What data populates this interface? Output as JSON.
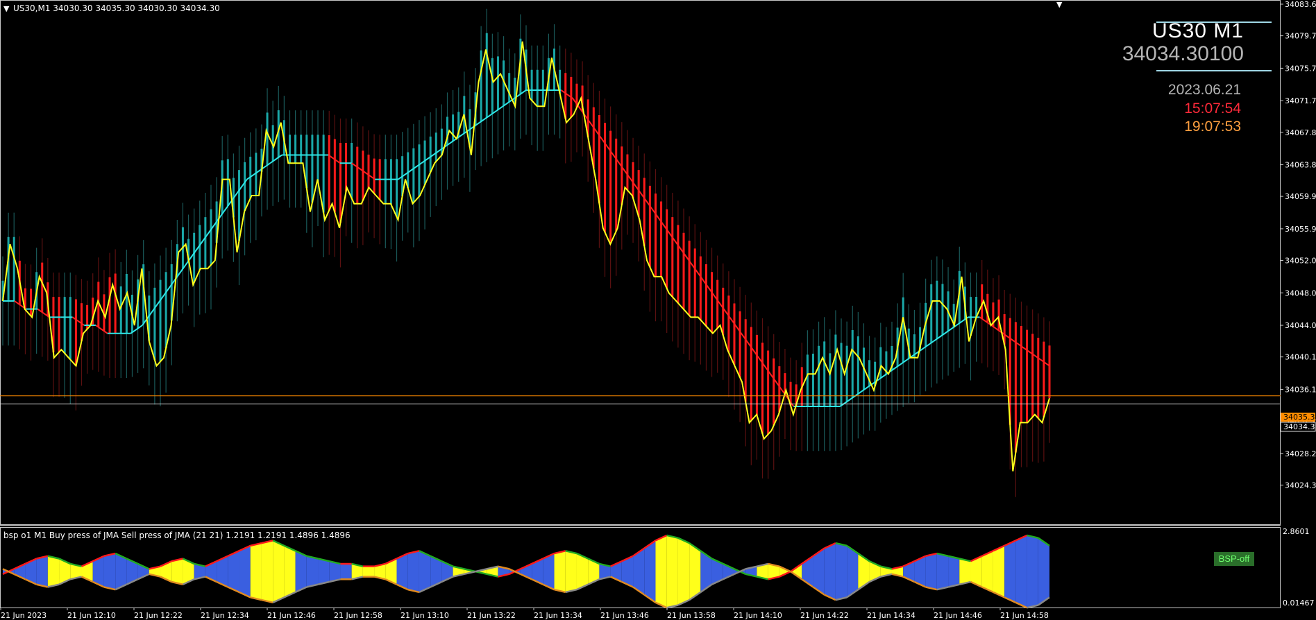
{
  "header": {
    "title": "US30,M1  34030.30 34035.30 34030.30 34034.30"
  },
  "info_panel": {
    "symbol": "US30  M1",
    "bid": "34034.30100",
    "date": "2023.06.21",
    "server_time": "15:07:54",
    "local_time": "19:07:53"
  },
  "sub_window": {
    "title": "bsp o1 M1 Buy press of JMA Sell press of JMA (21 21) 1.2191 1.2191 1.4896 1.4896",
    "y_max_label": "2.8601",
    "y_min_label": "0.01467",
    "button_label": "BSP-off"
  },
  "colors": {
    "bull_histogram": "#1aa8a8",
    "bear_histogram": "#ff1a1a",
    "price_line": "#ffff1a",
    "ma_up": "#2ee6e6",
    "ma_down": "#ff2020",
    "ask_line": "#ff8c00",
    "bid_line": "#e0e0e0",
    "osc_blue": "#3a5fe0",
    "osc_yellow": "#ffff1a",
    "osc_green": "#22aa22",
    "osc_red": "#ff1a1a"
  },
  "chart_data": [
    {
      "type": "line",
      "panel": "main",
      "ylim": [
        34021,
        34083.6
      ],
      "y_ticks": [
        "34083.6",
        "34079.7",
        "34075.7",
        "34071.7",
        "34067.8",
        "34063.8",
        "34059.9",
        "34055.9",
        "34052.0",
        "34048.0",
        "34044.0",
        "34040.1",
        "34036.1",
        "34032.2",
        "34028.2",
        "34024.3"
      ],
      "x_ticks": [
        "21 Jun 2023",
        "21 Jun 12:10",
        "21 Jun 12:22",
        "21 Jun 12:34",
        "21 Jun 12:46",
        "21 Jun 12:58",
        "21 Jun 13:10",
        "21 Jun 13:22",
        "21 Jun 13:34",
        "21 Jun 13:46",
        "21 Jun 13:58",
        "21 Jun 14:10",
        "21 Jun 14:22",
        "21 Jun 14:34",
        "21 Jun 14:46",
        "21 Jun 14:58"
      ],
      "price_labels": {
        "ask": "34035.3",
        "bid": "34034.3"
      },
      "ask_level": 34035.3,
      "bid_level": 34034.3,
      "bar_count": 187,
      "series": [
        {
          "values": [
            34047,
            34054,
            34051,
            34046,
            34045,
            34050,
            34048,
            34040,
            34041,
            34040,
            34039,
            34043,
            34044,
            34047,
            34045,
            34049,
            34046,
            34048,
            34044,
            34051,
            34042,
            34039,
            34040,
            34044,
            34053,
            34054,
            34049,
            34051,
            34051,
            34052,
            34062,
            34062,
            34053,
            34058,
            34060,
            34060,
            34068,
            34066,
            34069,
            34064,
            34064,
            34064,
            34058,
            34062,
            34057,
            34059,
            34056,
            34061,
            34059,
            34059,
            34061,
            34060,
            34059,
            34059,
            34057,
            34062,
            34059,
            34060,
            34062,
            34064,
            34065,
            34068,
            34067,
            34070,
            34065,
            34074,
            34078,
            34074,
            34075,
            34073,
            34071,
            34079,
            34072,
            34071,
            34071,
            34077,
            34073,
            34069,
            34070,
            34072,
            34067,
            34062,
            34056,
            34054,
            34056,
            34061,
            34060,
            34057,
            34052,
            34050,
            34050,
            34048,
            34047,
            34046,
            34045,
            34045,
            34044,
            34043,
            34044,
            34041,
            34039,
            34037,
            34032,
            34033,
            34030,
            34031,
            34033,
            34036,
            34033,
            34036,
            34038,
            34038,
            34040,
            34038,
            34041,
            34038,
            34041,
            34040,
            34038,
            34036,
            34039,
            34038,
            34040,
            34045,
            34040,
            34040,
            34044,
            34047,
            34047,
            34046,
            34044,
            34050,
            34042,
            34045,
            34047,
            34044,
            34045,
            34041,
            34026,
            34032,
            34032,
            34033,
            34032,
            34035
          ]
        },
        {
          "values": [
            34047,
            34047,
            34046,
            34046,
            34045,
            34045,
            34045,
            34044,
            34044,
            34043,
            34043,
            34043,
            34044,
            34046,
            34048,
            34050,
            34052,
            34054,
            34056,
            34058,
            34060,
            34062,
            34063,
            34064,
            34065,
            34065,
            34065,
            34065,
            34065,
            34064,
            34064,
            34063,
            34062,
            34062,
            34062,
            34063,
            34064,
            34065,
            34066,
            34067,
            34068,
            34069,
            34070,
            34071,
            34072,
            34073,
            34073,
            34073,
            34073,
            34072,
            34070,
            34068,
            34066,
            34064,
            34062,
            34060,
            34058,
            34056,
            34054,
            34052,
            34050,
            34048,
            34046,
            34044,
            34042,
            34040,
            34038,
            34036,
            34034,
            34034,
            34034,
            34034,
            34034,
            34035,
            34036,
            34037,
            34038,
            34039,
            34040,
            34041,
            34042,
            34043,
            34044,
            34045,
            34045,
            34044,
            34043,
            34042,
            34041,
            34040,
            34039
          ]
        }
      ]
    },
    {
      "type": "area",
      "panel": "sub",
      "ylim": [
        0.01467,
        2.8601
      ],
      "series": [
        {
          "values": [
            1.2,
            1.4,
            1.6,
            1.8,
            1.9,
            1.8,
            1.6,
            1.5,
            1.7,
            1.9,
            2.0,
            1.8,
            1.6,
            1.4,
            1.5,
            1.7,
            1.8,
            1.6,
            1.5,
            1.7,
            1.9,
            2.1,
            2.3,
            2.4,
            2.5,
            2.3,
            2.1,
            1.9,
            1.8,
            1.7,
            1.6,
            1.6,
            1.5,
            1.5,
            1.6,
            1.8,
            2.0,
            2.1,
            1.9,
            1.7,
            1.5,
            1.4,
            1.3,
            1.2,
            1.1,
            1.2,
            1.4,
            1.6,
            1.8,
            2.0,
            2.1,
            2.0,
            1.8,
            1.6,
            1.5,
            1.7,
            1.9,
            2.2,
            2.5,
            2.7,
            2.6,
            2.4,
            2.1,
            1.8,
            1.6,
            1.4,
            1.2,
            1.1,
            1.0,
            1.1,
            1.3,
            1.6,
            1.9,
            2.2,
            2.4,
            2.3,
            2.0,
            1.7,
            1.5,
            1.4,
            1.5,
            1.7,
            1.9,
            2.0,
            1.9,
            1.8,
            1.7,
            1.9,
            2.1,
            2.3,
            2.5,
            2.7,
            2.6,
            2.3
          ]
        }
      ]
    }
  ]
}
